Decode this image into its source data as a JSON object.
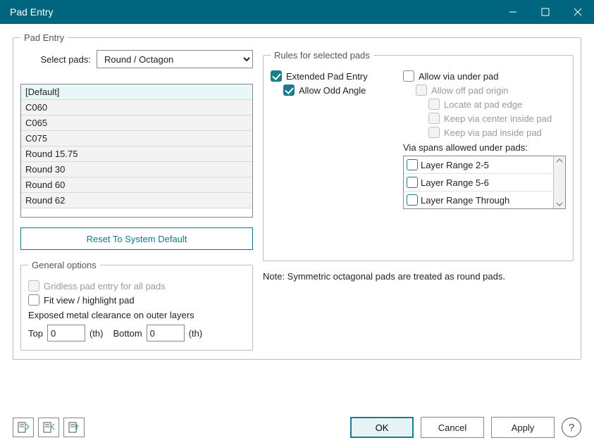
{
  "window": {
    "title": "Pad Entry"
  },
  "pad_entry": {
    "legend": "Pad Entry",
    "select_label": "Select pads:",
    "select_value": "Round / Octagon",
    "list": [
      "[Default]",
      "C060",
      "C065",
      "C075",
      "Round 15.75",
      "Round 30",
      "Round 60",
      "Round 62"
    ],
    "reset_label": "Reset To System Default",
    "general": {
      "legend": "General options",
      "gridless": "Gridless pad entry for all pads",
      "fitview": "Fit view / highlight pad",
      "clearance_label": "Exposed metal clearance on outer layers",
      "top_label": "Top",
      "top_value": "0",
      "top_unit": "(th)",
      "bottom_label": "Bottom",
      "bottom_value": "0",
      "bottom_unit": "(th)"
    }
  },
  "rules": {
    "legend": "Rules for selected pads",
    "extended": "Extended Pad Entry",
    "allow_odd": "Allow Odd Angle",
    "allow_via": "Allow via under pad",
    "allow_off": "Allow off pad origin",
    "locate_edge": "Locate at pad edge",
    "keep_center": "Keep via center inside pad",
    "keep_pad": "Keep via pad inside pad",
    "spans_label": "Via spans allowed under pads:",
    "spans": [
      "Layer Range 2-5",
      "Layer Range 5-6",
      "Layer Range Through"
    ]
  },
  "note": "Note: Symmetric octagonal pads are treated as round pads.",
  "buttons": {
    "ok": "OK",
    "cancel": "Cancel",
    "apply": "Apply"
  }
}
